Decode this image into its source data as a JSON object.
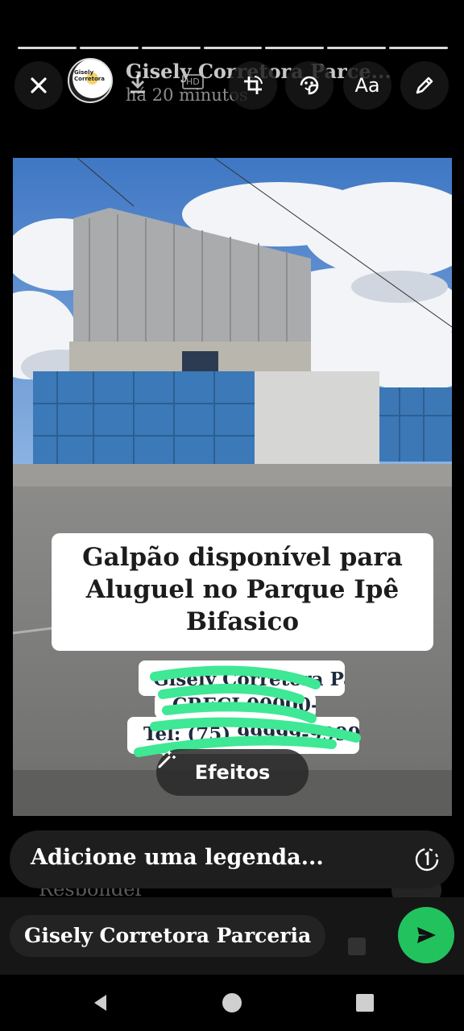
{
  "story": {
    "name": "Gisely Corretora Parce...",
    "time": "há 20 minutos",
    "segment_count": 7,
    "avatar_tag": "Gisely\nCorretora"
  },
  "toolbar": {
    "close_icon": "close-icon",
    "crop_icon": "crop-rotate-icon",
    "sticker_icon": "sticker-icon",
    "text_label": "Aa",
    "draw_icon": "pencil-icon",
    "hd_label": "HD"
  },
  "photo": {
    "title_lines": [
      "Galpão disponível para",
      "Aluguel no Parque Ipê",
      "Bifasico"
    ],
    "contact_line_1": "Gisely Corretora Parceiro",
    "contact_line_2": "CRECI 00000-9",
    "contact_line_3": "Tel: (75) 99999-9999",
    "effects_label": "Efeitos"
  },
  "caption": {
    "placeholder": "Adicione uma legenda...",
    "reply_ghost": "Responder"
  },
  "recipient": {
    "name": "Gisely Corretora Parceria"
  },
  "colors": {
    "send": "#22c35e",
    "scribble": "#3ee894"
  }
}
